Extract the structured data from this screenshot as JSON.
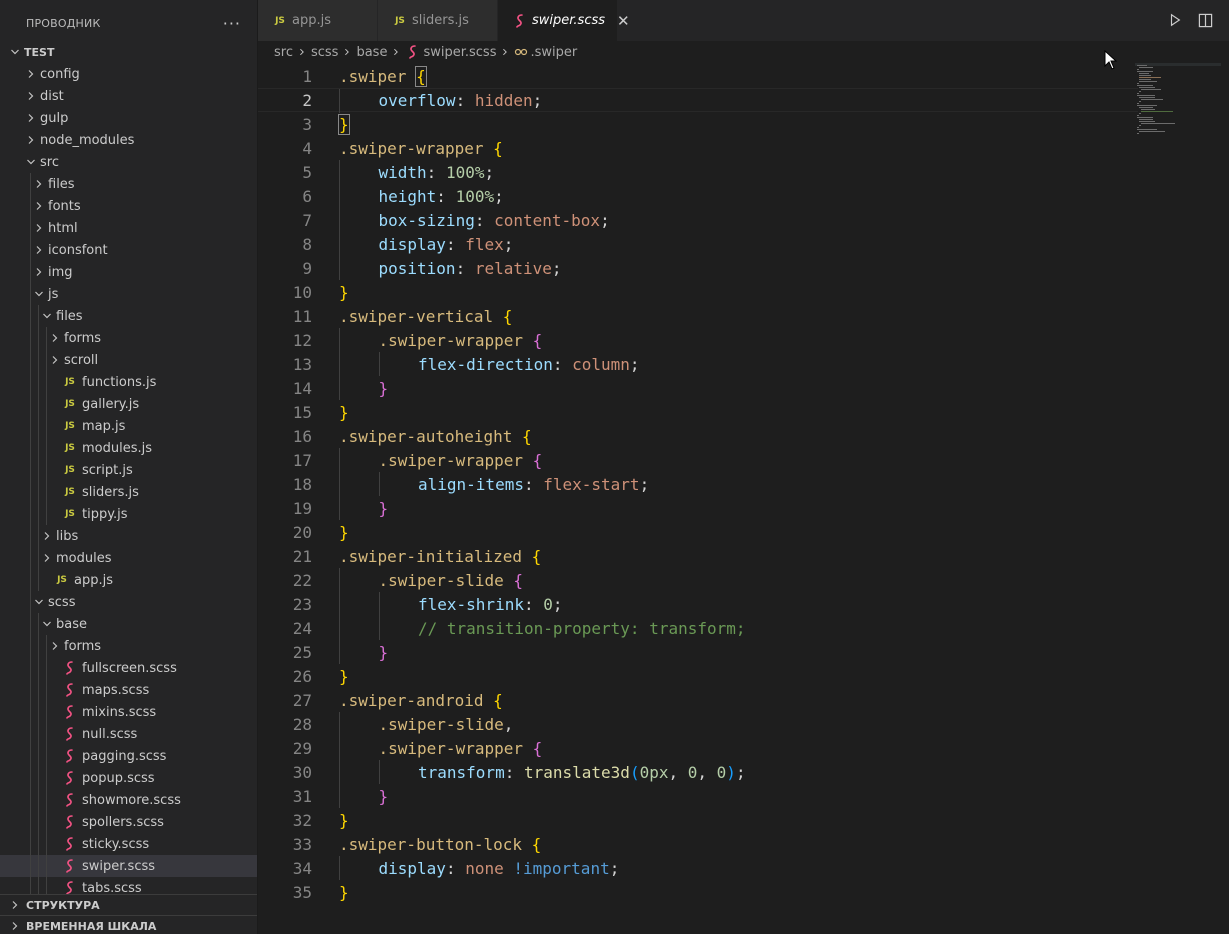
{
  "explorer": {
    "title": "ПРОВОДНИК",
    "more": "···",
    "tree": [
      {
        "label": "TEST",
        "type": "root",
        "depth": 0,
        "open": true
      },
      {
        "label": "config",
        "type": "folder",
        "depth": 1,
        "open": false
      },
      {
        "label": "dist",
        "type": "folder",
        "depth": 1,
        "open": false
      },
      {
        "label": "gulp",
        "type": "folder",
        "depth": 1,
        "open": false
      },
      {
        "label": "node_modules",
        "type": "folder",
        "depth": 1,
        "open": false
      },
      {
        "label": "src",
        "type": "folder",
        "depth": 1,
        "open": true
      },
      {
        "label": "files",
        "type": "folder",
        "depth": 2,
        "open": false
      },
      {
        "label": "fonts",
        "type": "folder",
        "depth": 2,
        "open": false
      },
      {
        "label": "html",
        "type": "folder",
        "depth": 2,
        "open": false
      },
      {
        "label": "iconsfont",
        "type": "folder",
        "depth": 2,
        "open": false
      },
      {
        "label": "img",
        "type": "folder",
        "depth": 2,
        "open": false
      },
      {
        "label": "js",
        "type": "folder",
        "depth": 2,
        "open": true
      },
      {
        "label": "files",
        "type": "folder",
        "depth": 3,
        "open": true
      },
      {
        "label": "forms",
        "type": "folder",
        "depth": 4,
        "open": false
      },
      {
        "label": "scroll",
        "type": "folder",
        "depth": 4,
        "open": false
      },
      {
        "label": "functions.js",
        "type": "js",
        "depth": 4
      },
      {
        "label": "gallery.js",
        "type": "js",
        "depth": 4
      },
      {
        "label": "map.js",
        "type": "js",
        "depth": 4
      },
      {
        "label": "modules.js",
        "type": "js",
        "depth": 4
      },
      {
        "label": "script.js",
        "type": "js",
        "depth": 4
      },
      {
        "label": "sliders.js",
        "type": "js",
        "depth": 4
      },
      {
        "label": "tippy.js",
        "type": "js",
        "depth": 4
      },
      {
        "label": "libs",
        "type": "folder",
        "depth": 3,
        "open": false
      },
      {
        "label": "modules",
        "type": "folder",
        "depth": 3,
        "open": false
      },
      {
        "label": "app.js",
        "type": "js",
        "depth": 3
      },
      {
        "label": "scss",
        "type": "folder",
        "depth": 2,
        "open": true
      },
      {
        "label": "base",
        "type": "folder",
        "depth": 3,
        "open": true
      },
      {
        "label": "forms",
        "type": "folder",
        "depth": 4,
        "open": false
      },
      {
        "label": "fullscreen.scss",
        "type": "scss",
        "depth": 4
      },
      {
        "label": "maps.scss",
        "type": "scss",
        "depth": 4
      },
      {
        "label": "mixins.scss",
        "type": "scss",
        "depth": 4
      },
      {
        "label": "null.scss",
        "type": "scss",
        "depth": 4
      },
      {
        "label": "pagging.scss",
        "type": "scss",
        "depth": 4
      },
      {
        "label": "popup.scss",
        "type": "scss",
        "depth": 4
      },
      {
        "label": "showmore.scss",
        "type": "scss",
        "depth": 4
      },
      {
        "label": "spollers.scss",
        "type": "scss",
        "depth": 4
      },
      {
        "label": "sticky.scss",
        "type": "scss",
        "depth": 4
      },
      {
        "label": "swiper.scss",
        "type": "scss",
        "depth": 4,
        "selected": true
      },
      {
        "label": "tabs.scss",
        "type": "scss",
        "depth": 4
      }
    ],
    "panels": [
      "СТРУКТУРА",
      "ВРЕМЕННАЯ ШКАЛА"
    ]
  },
  "tabs": [
    {
      "label": "app.js",
      "type": "js",
      "active": false
    },
    {
      "label": "sliders.js",
      "type": "js",
      "active": false
    },
    {
      "label": "swiper.scss",
      "type": "scss",
      "active": true
    }
  ],
  "tab_close": "✕",
  "breadcrumb": {
    "parts": [
      "src",
      "scss",
      "base"
    ],
    "file": "swiper.scss",
    "symbol": ".swiper"
  },
  "editor": {
    "current_line": 2,
    "lines": [
      {
        "n": "1",
        "indent": 0,
        "tokens": [
          {
            "t": ".swiper",
            "c": "sel"
          },
          {
            "t": " "
          },
          {
            "t": "{",
            "c": "b1 bmatch"
          }
        ]
      },
      {
        "n": "2",
        "indent": 1,
        "tokens": [
          {
            "t": "overflow",
            "c": "prop"
          },
          {
            "t": ": "
          },
          {
            "t": "hidden",
            "c": "val"
          },
          {
            "t": ";"
          }
        ]
      },
      {
        "n": "3",
        "indent": 0,
        "tokens": [
          {
            "t": "}",
            "c": "b1 bmatch"
          }
        ]
      },
      {
        "n": "4",
        "indent": 0,
        "tokens": [
          {
            "t": ".swiper-wrapper",
            "c": "sel"
          },
          {
            "t": " "
          },
          {
            "t": "{",
            "c": "b1"
          }
        ]
      },
      {
        "n": "5",
        "indent": 1,
        "tokens": [
          {
            "t": "width",
            "c": "prop"
          },
          {
            "t": ": "
          },
          {
            "t": "100%",
            "c": "num"
          },
          {
            "t": ";"
          }
        ]
      },
      {
        "n": "6",
        "indent": 1,
        "tokens": [
          {
            "t": "height",
            "c": "prop"
          },
          {
            "t": ": "
          },
          {
            "t": "100%",
            "c": "num"
          },
          {
            "t": ";"
          }
        ]
      },
      {
        "n": "7",
        "indent": 1,
        "tokens": [
          {
            "t": "box-sizing",
            "c": "prop"
          },
          {
            "t": ": "
          },
          {
            "t": "content-box",
            "c": "val"
          },
          {
            "t": ";"
          }
        ]
      },
      {
        "n": "8",
        "indent": 1,
        "tokens": [
          {
            "t": "display",
            "c": "prop"
          },
          {
            "t": ": "
          },
          {
            "t": "flex",
            "c": "val"
          },
          {
            "t": ";"
          }
        ]
      },
      {
        "n": "9",
        "indent": 1,
        "tokens": [
          {
            "t": "position",
            "c": "prop"
          },
          {
            "t": ": "
          },
          {
            "t": "relative",
            "c": "val"
          },
          {
            "t": ";"
          }
        ]
      },
      {
        "n": "10",
        "indent": 0,
        "tokens": [
          {
            "t": "}",
            "c": "b1"
          }
        ]
      },
      {
        "n": "11",
        "indent": 0,
        "tokens": [
          {
            "t": ".swiper-vertical",
            "c": "sel"
          },
          {
            "t": " "
          },
          {
            "t": "{",
            "c": "b1"
          }
        ]
      },
      {
        "n": "12",
        "indent": 1,
        "tokens": [
          {
            "t": ".swiper-wrapper",
            "c": "sel"
          },
          {
            "t": " "
          },
          {
            "t": "{",
            "c": "b2"
          }
        ]
      },
      {
        "n": "13",
        "indent": 2,
        "tokens": [
          {
            "t": "flex-direction",
            "c": "prop"
          },
          {
            "t": ": "
          },
          {
            "t": "column",
            "c": "val"
          },
          {
            "t": ";"
          }
        ]
      },
      {
        "n": "14",
        "indent": 1,
        "tokens": [
          {
            "t": "}",
            "c": "b2"
          }
        ]
      },
      {
        "n": "15",
        "indent": 0,
        "tokens": [
          {
            "t": "}",
            "c": "b1"
          }
        ]
      },
      {
        "n": "16",
        "indent": 0,
        "tokens": [
          {
            "t": ".swiper-autoheight",
            "c": "sel"
          },
          {
            "t": " "
          },
          {
            "t": "{",
            "c": "b1"
          }
        ]
      },
      {
        "n": "17",
        "indent": 1,
        "tokens": [
          {
            "t": ".swiper-wrapper",
            "c": "sel"
          },
          {
            "t": " "
          },
          {
            "t": "{",
            "c": "b2"
          }
        ]
      },
      {
        "n": "18",
        "indent": 2,
        "tokens": [
          {
            "t": "align-items",
            "c": "prop"
          },
          {
            "t": ": "
          },
          {
            "t": "flex-start",
            "c": "val"
          },
          {
            "t": ";"
          }
        ]
      },
      {
        "n": "19",
        "indent": 1,
        "tokens": [
          {
            "t": "}",
            "c": "b2"
          }
        ]
      },
      {
        "n": "20",
        "indent": 0,
        "tokens": [
          {
            "t": "}",
            "c": "b1"
          }
        ]
      },
      {
        "n": "21",
        "indent": 0,
        "tokens": [
          {
            "t": ".swiper-initialized",
            "c": "sel"
          },
          {
            "t": " "
          },
          {
            "t": "{",
            "c": "b1"
          }
        ]
      },
      {
        "n": "22",
        "indent": 1,
        "tokens": [
          {
            "t": ".swiper-slide",
            "c": "sel"
          },
          {
            "t": " "
          },
          {
            "t": "{",
            "c": "b2"
          }
        ]
      },
      {
        "n": "23",
        "indent": 2,
        "tokens": [
          {
            "t": "flex-shrink",
            "c": "prop"
          },
          {
            "t": ": "
          },
          {
            "t": "0",
            "c": "num"
          },
          {
            "t": ";"
          }
        ]
      },
      {
        "n": "24",
        "indent": 2,
        "tokens": [
          {
            "t": "// transition-property: transform;",
            "c": "cmt"
          }
        ]
      },
      {
        "n": "25",
        "indent": 1,
        "tokens": [
          {
            "t": "}",
            "c": "b2"
          }
        ]
      },
      {
        "n": "26",
        "indent": 0,
        "tokens": [
          {
            "t": "}",
            "c": "b1"
          }
        ]
      },
      {
        "n": "27",
        "indent": 0,
        "tokens": [
          {
            "t": ".swiper-android",
            "c": "sel"
          },
          {
            "t": " "
          },
          {
            "t": "{",
            "c": "b1"
          }
        ]
      },
      {
        "n": "28",
        "indent": 1,
        "tokens": [
          {
            "t": ".swiper-slide",
            "c": "sel"
          },
          {
            "t": ","
          }
        ]
      },
      {
        "n": "29",
        "indent": 1,
        "tokens": [
          {
            "t": ".swiper-wrapper",
            "c": "sel"
          },
          {
            "t": " "
          },
          {
            "t": "{",
            "c": "b2"
          }
        ]
      },
      {
        "n": "30",
        "indent": 2,
        "tokens": [
          {
            "t": "transform",
            "c": "prop"
          },
          {
            "t": ": "
          },
          {
            "t": "translate3d",
            "c": "fn"
          },
          {
            "t": "(",
            "c": "b3"
          },
          {
            "t": "0px",
            "c": "num"
          },
          {
            "t": ", "
          },
          {
            "t": "0",
            "c": "num"
          },
          {
            "t": ", "
          },
          {
            "t": "0",
            "c": "num"
          },
          {
            "t": ")",
            "c": "b3"
          },
          {
            "t": ";"
          }
        ]
      },
      {
        "n": "31",
        "indent": 1,
        "tokens": [
          {
            "t": "}",
            "c": "b2"
          }
        ]
      },
      {
        "n": "32",
        "indent": 0,
        "tokens": [
          {
            "t": "}",
            "c": "b1"
          }
        ]
      },
      {
        "n": "33",
        "indent": 0,
        "tokens": [
          {
            "t": ".swiper-button-lock",
            "c": "sel"
          },
          {
            "t": " "
          },
          {
            "t": "{",
            "c": "b1"
          }
        ]
      },
      {
        "n": "34",
        "indent": 1,
        "tokens": [
          {
            "t": "display",
            "c": "prop"
          },
          {
            "t": ": "
          },
          {
            "t": "none",
            "c": "val"
          },
          {
            "t": " "
          },
          {
            "t": "!important",
            "c": "imp"
          },
          {
            "t": ";"
          }
        ]
      },
      {
        "n": "35",
        "indent": 0,
        "tokens": [
          {
            "t": "}",
            "c": "b1"
          }
        ]
      }
    ]
  },
  "icons": {
    "more": "ellipsis-icon",
    "run": "play-icon",
    "split": "split-editor-icon",
    "close": "close-icon"
  },
  "colors": {
    "js_icon": "#cbcb41",
    "scss_icon": "#f55385",
    "selected_row": "#37373d"
  }
}
